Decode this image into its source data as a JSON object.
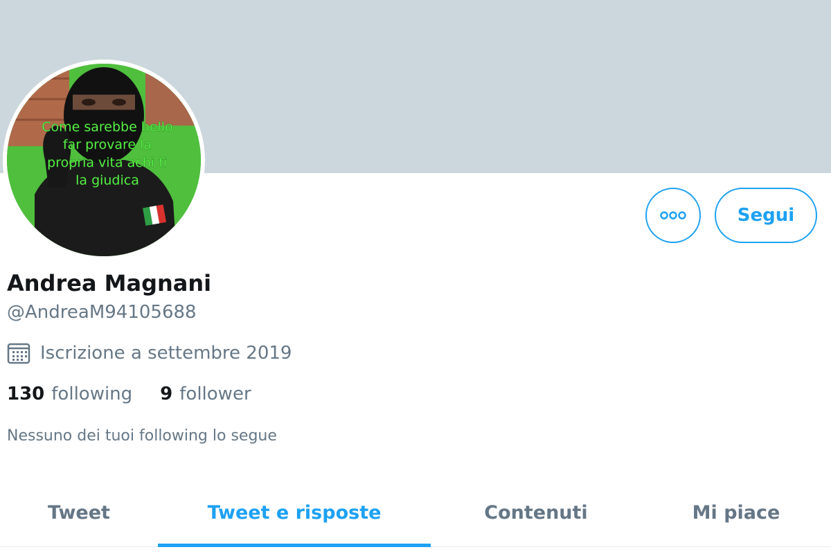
{
  "profile": {
    "display_name": "Andrea Magnani",
    "handle": "@AndreaM94105688",
    "joined": "Iscrizione a settembre 2019",
    "avatar_overlay_text": [
      "Come sarebbe bello",
      "far provare la",
      "propria vita achi ti",
      "la giudica"
    ],
    "followed_by": "Nessuno dei tuoi following lo segue"
  },
  "stats": {
    "following_count": "130",
    "following_label": "following",
    "follower_count": "9",
    "follower_label": "follower"
  },
  "actions": {
    "follow_label": "Segui",
    "more_icon": "more-horizontal-icon"
  },
  "tabs": [
    {
      "label": "Tweet",
      "active": false
    },
    {
      "label": "Tweet e risposte",
      "active": true
    },
    {
      "label": "Contenuti",
      "active": false
    },
    {
      "label": "Mi piace",
      "active": false
    }
  ],
  "colors": {
    "banner": "#ccd6dd",
    "accent": "#1da1f2",
    "secondary_text": "#657786",
    "primary_text": "#14171a",
    "avatar_green": "#4caf3a"
  }
}
